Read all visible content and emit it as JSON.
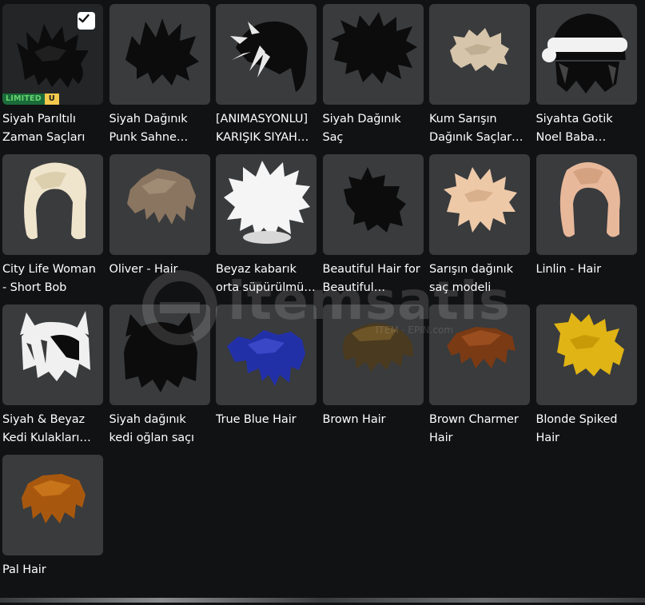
{
  "items": [
    {
      "name": "Siyah Parıltılı Zaman Saçları",
      "selected": true,
      "limited_label": "LIMITED",
      "limited_u": "U",
      "hair": "black-spiky"
    },
    {
      "name": "Siyah Dağınık Punk Sahne…",
      "hair": "black-punk"
    },
    {
      "name": "[ANIMASYONLU] KARIŞIK SIYAH…",
      "hair": "black-white-animated"
    },
    {
      "name": "Siyah Dağınık Saç",
      "hair": "black-messy"
    },
    {
      "name": "Kum Sarışın Dağınık Saçlar…",
      "hair": "sand-blonde"
    },
    {
      "name": "Siyahta Gotik Noel Baba…",
      "hair": "santa-hat"
    },
    {
      "name": "City Life Woman - Short Bob",
      "hair": "blonde-bob"
    },
    {
      "name": "Oliver - Hair",
      "hair": "brown-oliver"
    },
    {
      "name": "Beyaz kabarık orta süpürülmü…",
      "hair": "white-fluffy"
    },
    {
      "name": "Beautiful Hair for Beautiful…",
      "hair": "black-beautiful"
    },
    {
      "name": "Sarışın dağınık saç modeli",
      "hair": "blonde-messy"
    },
    {
      "name": "Linlin - Hair",
      "hair": "peach-bob"
    },
    {
      "name": "Siyah & Beyaz Kedi Kulakları…",
      "hair": "cat-bw"
    },
    {
      "name": "Siyah dağınık kedi oğlan saçı",
      "hair": "cat-black"
    },
    {
      "name": "True Blue Hair",
      "hair": "blue"
    },
    {
      "name": "Brown Hair",
      "hair": "brown"
    },
    {
      "name": "Brown Charmer Hair",
      "hair": "brown-charmer"
    },
    {
      "name": "Blonde Spiked Hair",
      "hair": "blonde-spiked"
    },
    {
      "name": "Pal Hair",
      "hair": "pal"
    }
  ],
  "colors": {
    "background": "#111214",
    "card": "#393b3d",
    "card_selected": "#232527",
    "text": "#ffffff"
  }
}
